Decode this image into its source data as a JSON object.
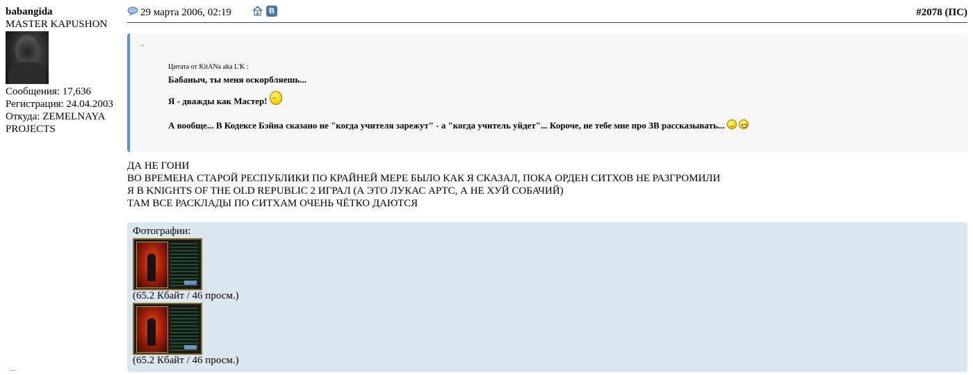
{
  "user": {
    "name": "babangida",
    "title": "MASTER KAPUSHON",
    "posts_label": "Сообщения: 17,636",
    "reg_label": "Регистрация: 24.04.2003",
    "from_label": "Откуда: ZEMELNAYA PROJECTS"
  },
  "post": {
    "date": "29 марта 2006, 02:19",
    "number": "#2078",
    "tag": " (ПС)"
  },
  "quote": {
    "dash": "-",
    "author": "Цитата от KitANa aka L'K :",
    "line1": "Бабаныч, ты меня оскорбляешь...",
    "line2": "Я - дважды как Мастер!",
    "line3": "А вообще... В Кодексе Бэйна сказано не \"когда учителя зарежут\" - а \"когда учитель уйдет\"... Короче, не тебе мне про ЗВ рассказывать..."
  },
  "body": {
    "line1": "ДА НЕ ГОНИ",
    "line2": "ВО ВРЕМЕНА СТАРОЙ РЕСПУБЛИКИ ПО КРАЙНЕЙ МЕРЕ БЫЛО КАК Я СКАЗАЛ, ПОКА ОРДЕН СИТХОВ НЕ РАЗГРОМИЛИ",
    "line3": "Я В KNIGHTS OF THE OLD REPUBLIC 2 ИГРАЛ (А ЭТО ЛУКАС АРТС, А НЕ ХУЙ СОБАЧИЙ)",
    "line4": "ТАМ ВСЕ РАСКЛАДЫ ПО СИТХАМ ОЧЕНЬ ЧЁТКО ДАЮТСЯ"
  },
  "attachments": {
    "title": "Фотографии:",
    "items": [
      {
        "meta": "(65.2 Кбайт / 46 просм.)"
      },
      {
        "meta": "(65.2 Кбайт / 46 просм.)"
      }
    ]
  },
  "icons": {
    "vk_letter": "В",
    "accent": "#5a8ee0",
    "header_line": "#33466b",
    "attach_bg": "#dce6ee"
  }
}
